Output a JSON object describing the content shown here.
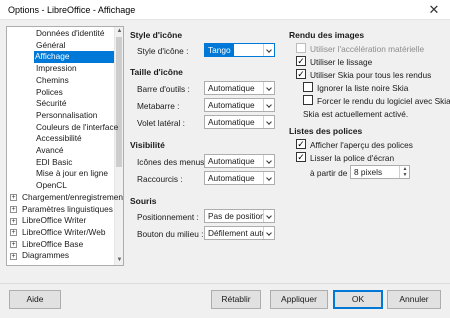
{
  "window": {
    "title": "Options - LibreOffice - Affichage",
    "close_glyph": "✕"
  },
  "tree": {
    "items": [
      {
        "label": "Données d'identité",
        "expander": ""
      },
      {
        "label": "Général",
        "expander": ""
      },
      {
        "label": "Affichage",
        "expander": "",
        "selected": true
      },
      {
        "label": "Impression",
        "expander": ""
      },
      {
        "label": "Chemins",
        "expander": ""
      },
      {
        "label": "Polices",
        "expander": ""
      },
      {
        "label": "Sécurité",
        "expander": ""
      },
      {
        "label": "Personnalisation",
        "expander": ""
      },
      {
        "label": "Couleurs de l'interface",
        "expander": ""
      },
      {
        "label": "Accessibilité",
        "expander": ""
      },
      {
        "label": "Avancé",
        "expander": ""
      },
      {
        "label": "EDI Basic",
        "expander": ""
      },
      {
        "label": "Mise à jour en ligne",
        "expander": ""
      },
      {
        "label": "OpenCL",
        "expander": ""
      },
      {
        "label": "Chargement/enregistrement",
        "expander": "+"
      },
      {
        "label": "Paramètres linguistiques",
        "expander": "+"
      },
      {
        "label": "LibreOffice Writer",
        "expander": "+"
      },
      {
        "label": "LibreOffice Writer/Web",
        "expander": "+"
      },
      {
        "label": "LibreOffice Base",
        "expander": "+"
      },
      {
        "label": "Diagrammes",
        "expander": "+"
      }
    ]
  },
  "icon_style": {
    "heading": "Style d'icône",
    "label": "Style d'icône :",
    "value": "Tango"
  },
  "icon_size": {
    "heading": "Taille d'icône",
    "toolbar_label": "Barre d'outils :",
    "toolbar_value": "Automatique",
    "sidebar_label": "Metabarre :",
    "sidebar_value": "Automatique",
    "side_panel_label": "Volet latéral :",
    "side_panel_value": "Automatique"
  },
  "visibility": {
    "heading": "Visibilité",
    "menu_icons_label": "Icônes des menus :",
    "menu_icons_value": "Automatique",
    "shortcuts_label": "Raccourcis :",
    "shortcuts_value": "Automatique"
  },
  "mouse": {
    "heading": "Souris",
    "positioning_label": "Positionnement :",
    "positioning_value": "Pas de positionn",
    "middle_button_label": "Bouton du milieu :",
    "middle_button_value": "Défilement autor"
  },
  "graphics_output": {
    "heading": "Rendu des images",
    "hw_accel": {
      "label": "Utiliser l'accélération matérielle",
      "checked": false,
      "disabled": true
    },
    "antialias": {
      "label": "Utiliser le lissage",
      "checked": true
    },
    "skia": {
      "label": "Utiliser Skia pour tous les rendus",
      "checked": true
    },
    "ignore_denylist": {
      "label": "Ignorer la liste noire Skia",
      "checked": false
    },
    "force_software": {
      "label": "Forcer le rendu du logiciel avec Skia",
      "checked": false
    },
    "skia_status": "Skia est actuellement activé."
  },
  "font_lists": {
    "heading": "Listes des polices",
    "preview": {
      "label": "Afficher l'aperçu des polices",
      "checked": true
    },
    "smooth": {
      "label": "Lisser la police d'écran",
      "checked": true
    },
    "from_label": "à partir de :",
    "from_value": "8 pixels"
  },
  "buttons": {
    "help": "Aide",
    "reset": "Rétablir",
    "apply": "Appliquer",
    "ok": "OK",
    "cancel": "Annuler"
  },
  "colors": {
    "accent": "#0078d7",
    "selection_text": "#ffffff",
    "disabled_text": "#8c8c8c"
  },
  "check_glyph": "✓"
}
